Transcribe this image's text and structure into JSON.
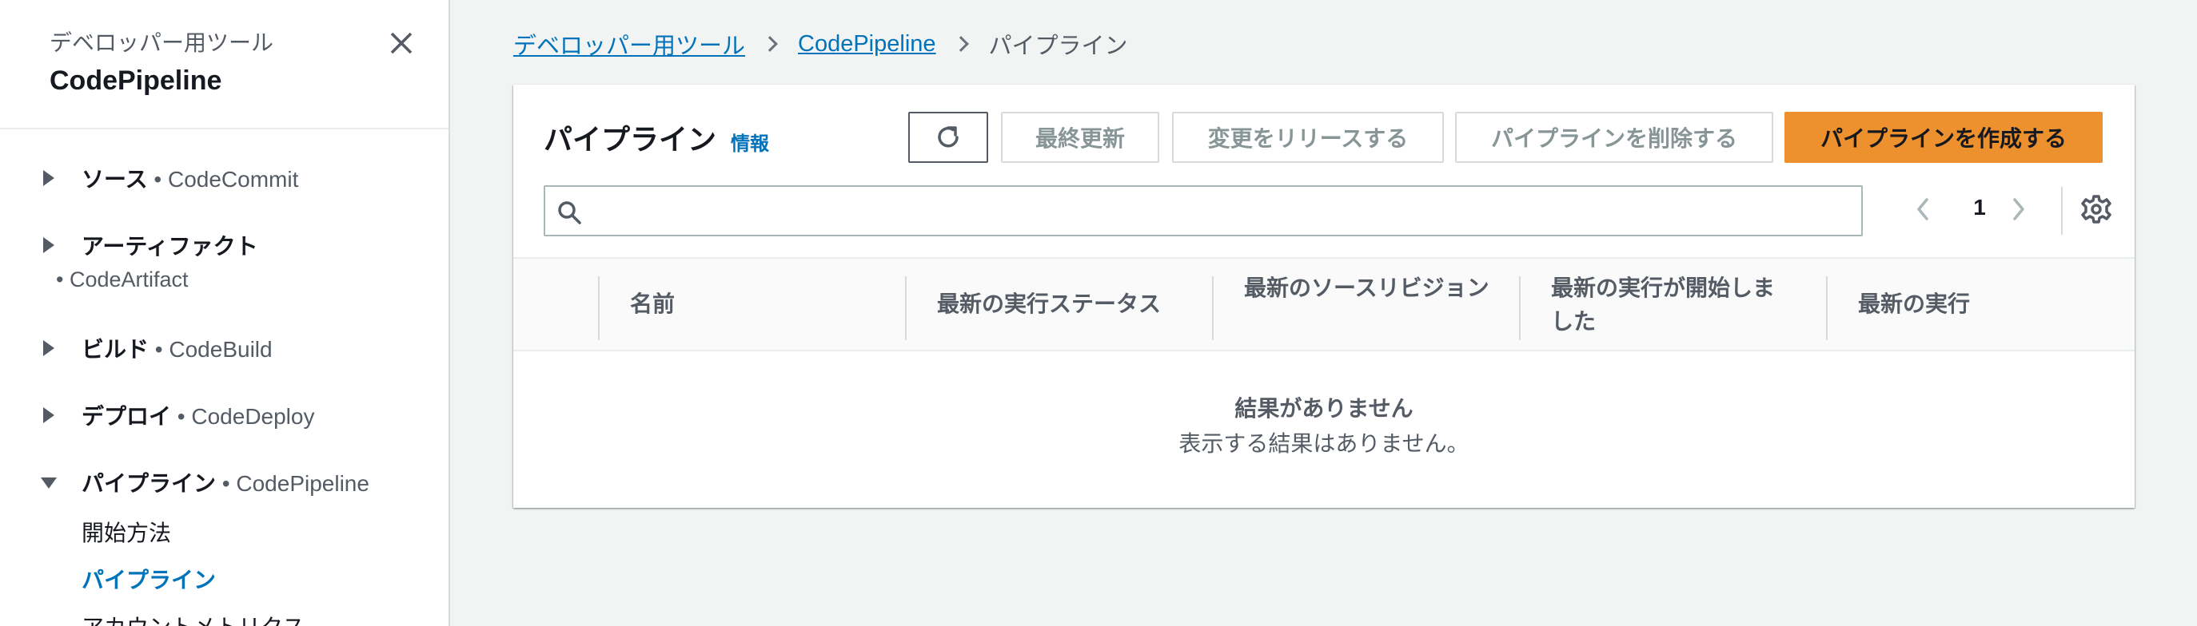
{
  "sidebar": {
    "subtitle": "デベロッパー用ツール",
    "title": "CodePipeline",
    "sections": [
      {
        "label": "ソース",
        "service": "• CodeCommit"
      },
      {
        "label": "アーティファクト",
        "service": "• CodeArtifact"
      },
      {
        "label": "ビルド",
        "service": "• CodeBuild"
      },
      {
        "label": "デプロイ",
        "service": "• CodeDeploy"
      },
      {
        "label": "パイプライン",
        "service": "• CodePipeline"
      }
    ],
    "sub_items": [
      "開始方法",
      "パイプライン",
      "アカウントメトリクス"
    ]
  },
  "breadcrumb": {
    "items": [
      "デベロッパー用ツール",
      "CodePipeline"
    ],
    "current": "パイプライン"
  },
  "panel": {
    "title": "パイプライン",
    "info": "情報",
    "buttons": {
      "last_updated": "最終更新",
      "release_change": "変更をリリースする",
      "delete": "パイプラインを削除する",
      "create": "パイプラインを作成する"
    },
    "search": {
      "placeholder": "",
      "value": ""
    },
    "page": "1",
    "columns": [
      "名前",
      "最新の実行ステータス",
      "最新のソースリビジョン",
      "最新の実行が開始しました",
      "最新の実行"
    ],
    "empty": {
      "title": "結果がありません",
      "description": "表示する結果はありません。"
    }
  },
  "icons": {
    "close": "close-icon",
    "refresh": "refresh-icon",
    "search": "search-icon",
    "prev": "chevron-left-icon",
    "next": "chevron-right-icon",
    "settings": "gear-icon"
  },
  "colors": {
    "link": "#0073bb",
    "primary": "#ec912d",
    "background": "#f2f3f3"
  }
}
